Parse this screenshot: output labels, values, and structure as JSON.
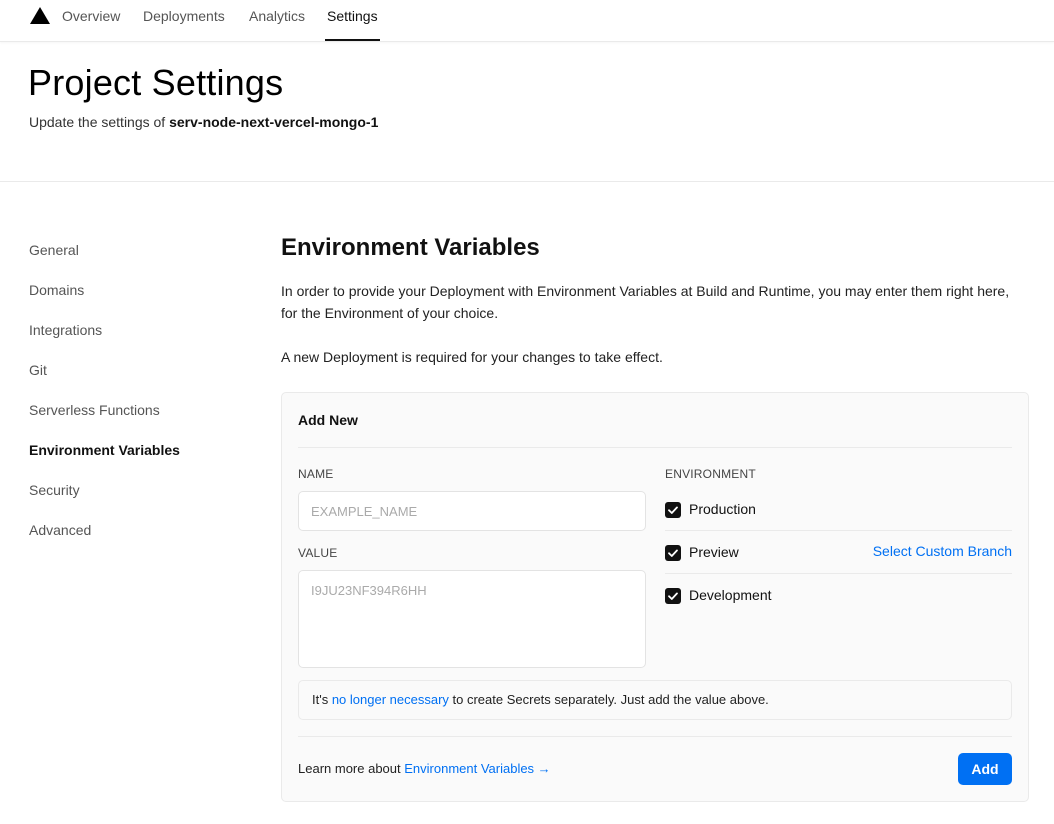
{
  "nav": {
    "logo_icon": "triangle-logo",
    "tabs": [
      {
        "label": "Overview"
      },
      {
        "label": "Deployments"
      },
      {
        "label": "Analytics"
      },
      {
        "label": "Settings",
        "active": true
      }
    ]
  },
  "header": {
    "title": "Project Settings",
    "subtitle_prefix": "Update the settings of ",
    "project_name": "serv-node-next-vercel-mongo-1"
  },
  "sidebar": {
    "items": [
      {
        "label": "General"
      },
      {
        "label": "Domains"
      },
      {
        "label": "Integrations"
      },
      {
        "label": "Git"
      },
      {
        "label": "Serverless Functions"
      },
      {
        "label": "Environment Variables",
        "active": true
      },
      {
        "label": "Security"
      },
      {
        "label": "Advanced"
      }
    ]
  },
  "main": {
    "title": "Environment Variables",
    "desc_line1": "In order to provide your Deployment with Environment Variables at Build and Runtime, you may enter them right here,",
    "desc_line2": "for the Environment of your choice.",
    "desc_note": "A new Deployment is required for your changes to take effect.",
    "card": {
      "title": "Add New",
      "name_label": "NAME",
      "name_placeholder": "EXAMPLE_NAME",
      "value_label": "VALUE",
      "value_placeholder": "I9JU23NF394R6HH",
      "environment_label": "ENVIRONMENT",
      "environments": [
        {
          "label": "Production",
          "checked": true
        },
        {
          "label": "Preview",
          "checked": true
        },
        {
          "label": "Development",
          "checked": true
        }
      ],
      "custom_branch_link": "Select Custom Branch",
      "note_prefix": "It's ",
      "note_link": "no longer necessary",
      "note_suffix": " to create Secrets separately. Just add the value above.",
      "footer_prefix": "Learn more about ",
      "footer_link": "Environment Variables →",
      "add_button": "Add"
    }
  },
  "colors": {
    "accent": "#0070f3",
    "checkbox": "#111111",
    "card_bg": "#fafafa",
    "border": "#eaeaea"
  }
}
